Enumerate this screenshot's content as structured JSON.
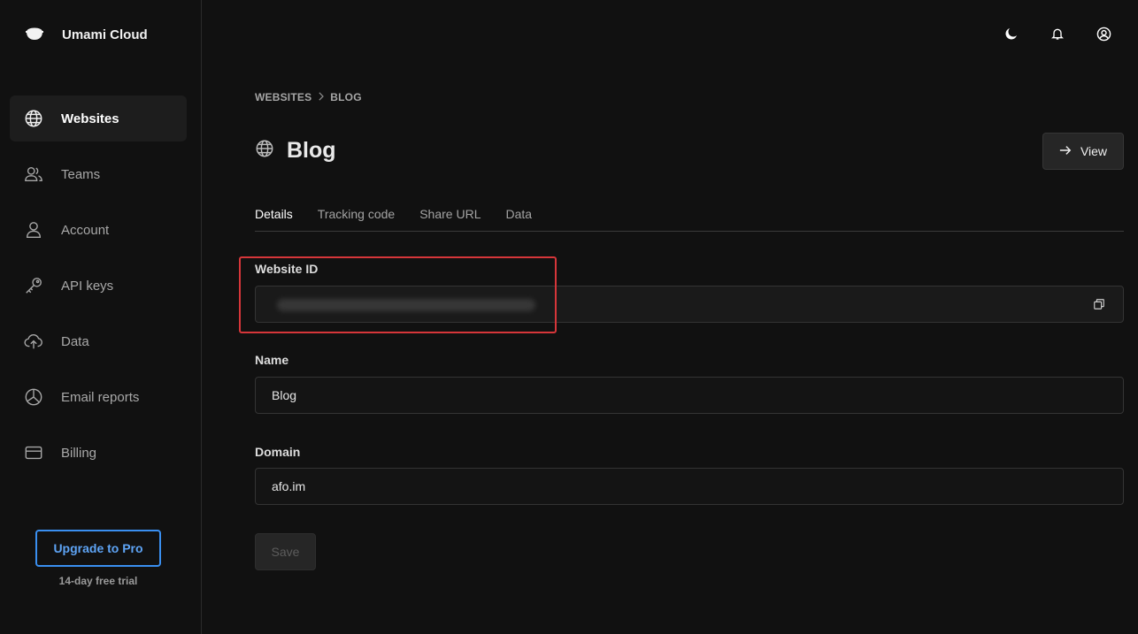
{
  "app": {
    "name": "Umami Cloud"
  },
  "sidebar": {
    "items": [
      {
        "label": "Websites",
        "icon": "globe-icon",
        "active": true
      },
      {
        "label": "Teams",
        "icon": "users-icon"
      },
      {
        "label": "Account",
        "icon": "user-icon"
      },
      {
        "label": "API keys",
        "icon": "key-icon"
      },
      {
        "label": "Data",
        "icon": "cloud-upload-icon"
      },
      {
        "label": "Email reports",
        "icon": "pie-chart-icon"
      },
      {
        "label": "Billing",
        "icon": "credit-card-icon"
      }
    ],
    "upgrade_label": "Upgrade to Pro",
    "trial_text": "14-day free trial"
  },
  "topbar": {
    "icons": [
      "moon-icon",
      "bell-icon",
      "user-circle-icon"
    ]
  },
  "breadcrumb": {
    "parent": "WEBSITES",
    "separator": "›",
    "current": "BLOG"
  },
  "page": {
    "title": "Blog",
    "title_icon": "globe-icon",
    "view_label": "View"
  },
  "tabs": [
    {
      "label": "Details",
      "active": true
    },
    {
      "label": "Tracking code"
    },
    {
      "label": "Share URL"
    },
    {
      "label": "Data"
    }
  ],
  "form": {
    "website_id": {
      "label": "Website ID",
      "value": ""
    },
    "name": {
      "label": "Name",
      "value": "Blog"
    },
    "domain": {
      "label": "Domain",
      "value": "afo.im"
    },
    "save_label": "Save"
  },
  "colors": {
    "background": "#111111",
    "accent": "#3a8ff0",
    "highlight": "#d6363a"
  }
}
